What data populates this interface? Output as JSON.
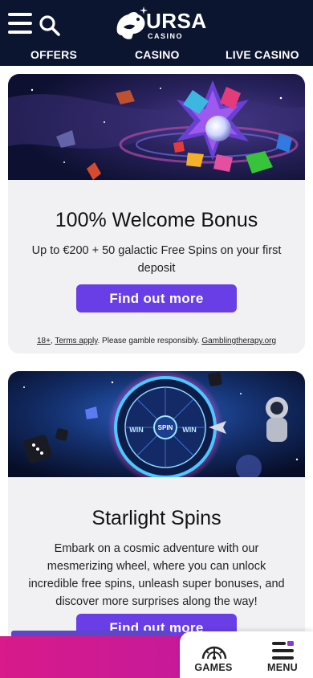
{
  "header": {
    "brand": "URSA",
    "brand_sub": "CASINO",
    "nav": [
      {
        "label": "OFFERS"
      },
      {
        "label": "CASINO"
      },
      {
        "label": "LIVE CASINO"
      }
    ]
  },
  "promotions": [
    {
      "title": "100% Welcome Bonus",
      "description": "Up to €200 + 50 galactic Free Spins on your first deposit",
      "cta": "Find out more",
      "terms": {
        "age": "18+",
        "sep1": ", ",
        "terms_link": "Terms apply",
        "middle": ". Please gamble responsibly. ",
        "help_link": "Gamblingtherapy.org"
      }
    },
    {
      "title": "Starlight Spins",
      "description": "Embark on a cosmic adventure with our mesmerizing wheel, where you can unlock incredible free spins, unleash super bonuses, and discover more surprises along the way!",
      "cta": "Find out more"
    }
  ],
  "bottom_nav": {
    "games": "GAMES",
    "menu": "MENU"
  },
  "wheel_labels": [
    "WIN",
    "WIN",
    "SPIN"
  ],
  "colors": {
    "header_bg": "#0c1530",
    "cta": "#6a3ee6",
    "card_bg": "#f1f1f4",
    "bottom_pink": "#d81a8a",
    "menu_accent": "#8a3ad6"
  },
  "icons": [
    "menu-icon",
    "search-icon",
    "bear-logo-icon",
    "games-icon",
    "menu-grid-icon"
  ]
}
